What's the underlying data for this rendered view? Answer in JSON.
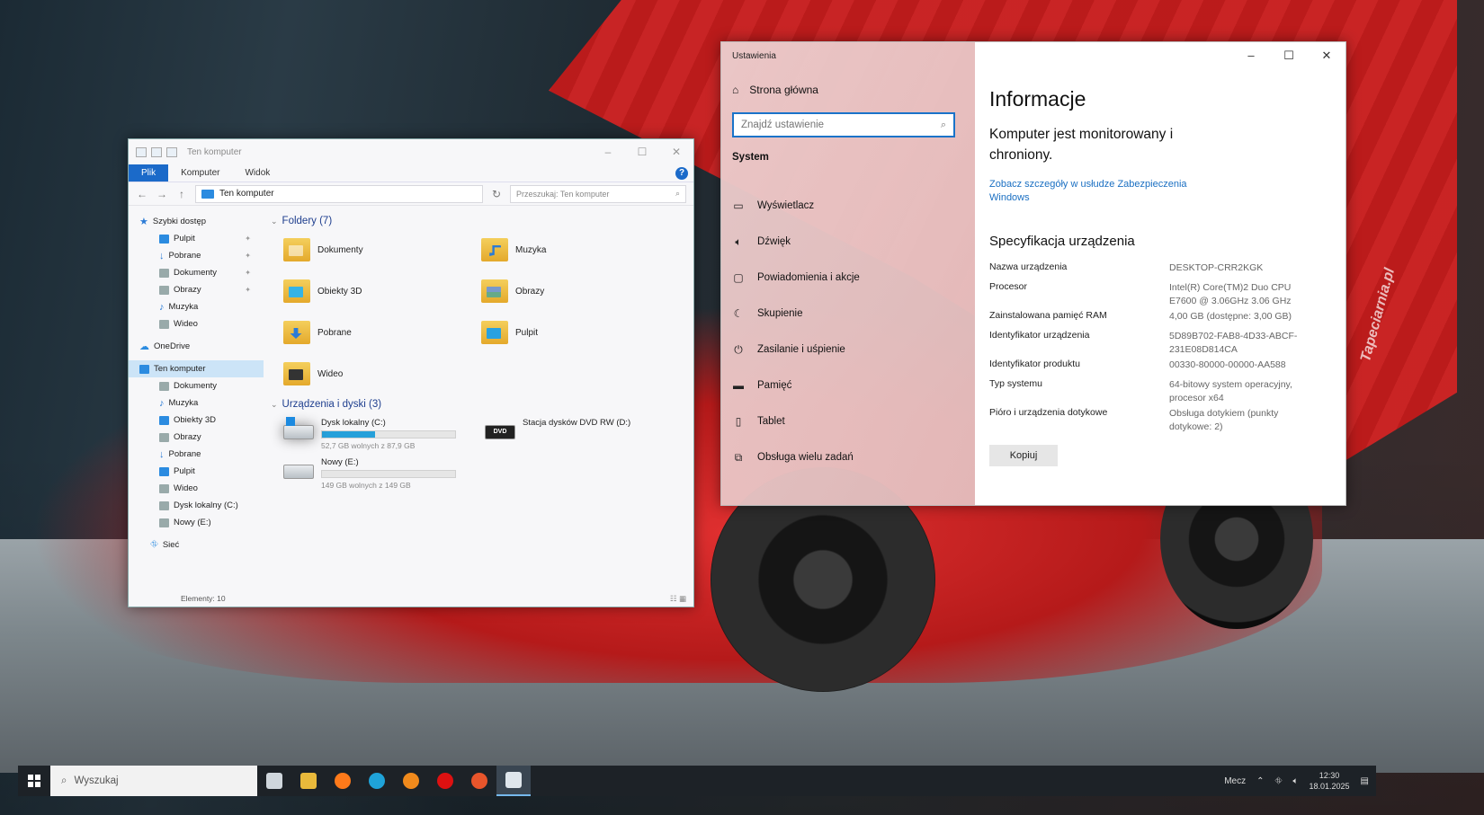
{
  "explorer": {
    "title": "Ten komputer",
    "ribbon_tabs": [
      "Plik",
      "Komputer",
      "Widok"
    ],
    "address": "Ten komputer",
    "search_placeholder": "Przeszukaj: Ten komputer",
    "nav": {
      "quick_access": "Szybki dostęp",
      "quick_items": [
        "Pulpit",
        "Pobrane",
        "Dokumenty",
        "Obrazy",
        "Muzyka",
        "Wideo"
      ],
      "onedrive": "OneDrive",
      "this_pc": "Ten komputer",
      "pc_items": [
        "Dokumenty",
        "Muzyka",
        "Obiekty 3D",
        "Obrazy",
        "Pobrane",
        "Pulpit",
        "Wideo",
        "Dysk lokalny (C:)",
        "Nowy (E:)"
      ],
      "network": "Sieć"
    },
    "folders_header": "Foldery (7)",
    "folders": [
      "Dokumenty",
      "Muzyka",
      "Obiekty 3D",
      "Obrazy",
      "Pobrane",
      "Pulpit",
      "Wideo"
    ],
    "drives_header": "Urządzenia i dyski (3)",
    "drives": [
      {
        "name": "Dysk lokalny (C:)",
        "free": "52,7 GB wolnych z 87,9 GB",
        "used_fraction": 0.4
      },
      {
        "name": "Stacja dysków DVD RW (D:)"
      },
      {
        "name": "Nowy (E:)",
        "free": "149 GB wolnych z 149 GB",
        "used_fraction": 0.0
      }
    ],
    "dvd_label": "DVD",
    "status": "Elementy: 10"
  },
  "settings": {
    "title": "Ustawienia",
    "home": "Strona główna",
    "search_placeholder": "Znajdź ustawienie",
    "section": "System",
    "menu": [
      "Wyświetlacz",
      "Dźwięk",
      "Powiadomienia i akcje",
      "Skupienie",
      "Zasilanie i uśpienie",
      "Pamięć",
      "Tablet",
      "Obsługa wielu zadań"
    ],
    "heading": "Informacje",
    "protection": "Komputer jest monitorowany i chroniony.",
    "link": "Zobacz szczegóły w usłudze Zabezpieczenia Windows",
    "spec_heading": "Specyfikacja urządzenia",
    "specs": [
      {
        "k": "Nazwa urządzenia",
        "v": "DESKTOP-CRR2KGK"
      },
      {
        "k": "Procesor",
        "v": "Intel(R) Core(TM)2 Duo CPU E7600 @ 3.06GHz 3.06 GHz"
      },
      {
        "k": "Zainstalowana pamięć RAM",
        "v": "4,00 GB (dostępne: 3,00 GB)"
      },
      {
        "k": "Identyfikator urządzenia",
        "v": "5D89B702-FAB8-4D33-ABCF-231E08D814CA"
      },
      {
        "k": "Identyfikator produktu",
        "v": "00330-80000-00000-AA588"
      },
      {
        "k": "Typ systemu",
        "v": "64-bitowy system operacyjny, procesor x64"
      },
      {
        "k": "Pióro i urządzenia dotykowe",
        "v": "Obsługa dotykiem (punkty dotykowe: 2)"
      }
    ],
    "copy_button": "Kopiuj"
  },
  "taskbar": {
    "search": "Wyszukaj",
    "weather": "Mecz",
    "time": "12:30",
    "date": "18.01.2025",
    "apps": [
      {
        "name": "task-view",
        "color": "#cfd6dc"
      },
      {
        "name": "file-explorer",
        "color": "#e9b93b"
      },
      {
        "name": "firefox",
        "color": "#ff7a1a"
      },
      {
        "name": "edge",
        "color": "#1fa3d9"
      },
      {
        "name": "avast",
        "color": "#f08a1c"
      },
      {
        "name": "opera",
        "color": "#d11"
      },
      {
        "name": "paint",
        "color": "#e8552b"
      },
      {
        "name": "settings",
        "color": "#dfe6ec"
      }
    ]
  },
  "wallpaper": {
    "watermark": "Tapeciarnia.pl"
  }
}
